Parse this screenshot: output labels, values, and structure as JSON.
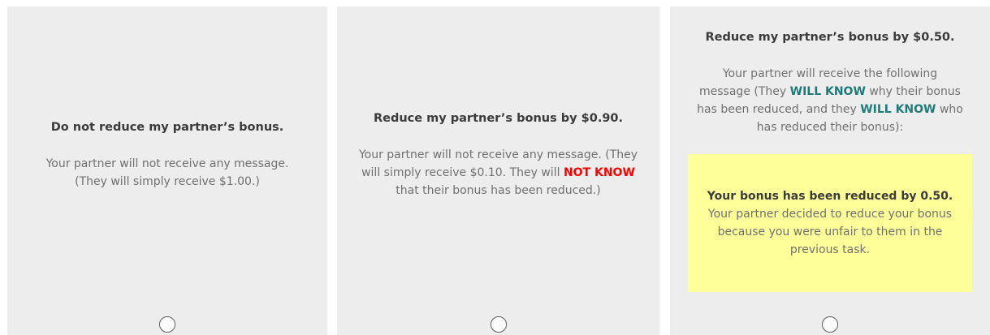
{
  "options": [
    {
      "title": "Do not reduce my partner’s bonus.",
      "desc": "Your partner will not receive any message. (They will simply receive $1.00.)"
    },
    {
      "title": "Reduce my partner’s bonus by $0.90.",
      "desc_before": "Your partner will not receive any message. (They will simply receive $0.10. They will ",
      "desc_emph": "NOT KNOW",
      "desc_after": " that their bonus has been reduced.)"
    },
    {
      "title": "Reduce my partner’s bonus by $0.50.",
      "desc_p1": "Your partner will receive the following message (They ",
      "desc_emph1": "WILL KNOW",
      "desc_p2": " why their bonus has been reduced, and they ",
      "desc_emph2": "WILL KNOW",
      "desc_p3": " who has reduced their bonus):",
      "message_strong": "Your bonus has been reduced by 0.50.",
      "message_rest": " Your partner decided to reduce your bonus because you were unfair to them in the previous task."
    }
  ],
  "colors": {
    "card_bg": "#ededed",
    "emphasis_red": "#ff0000",
    "emphasis_teal": "#1f7a7a",
    "message_bg": "#ffff99"
  }
}
